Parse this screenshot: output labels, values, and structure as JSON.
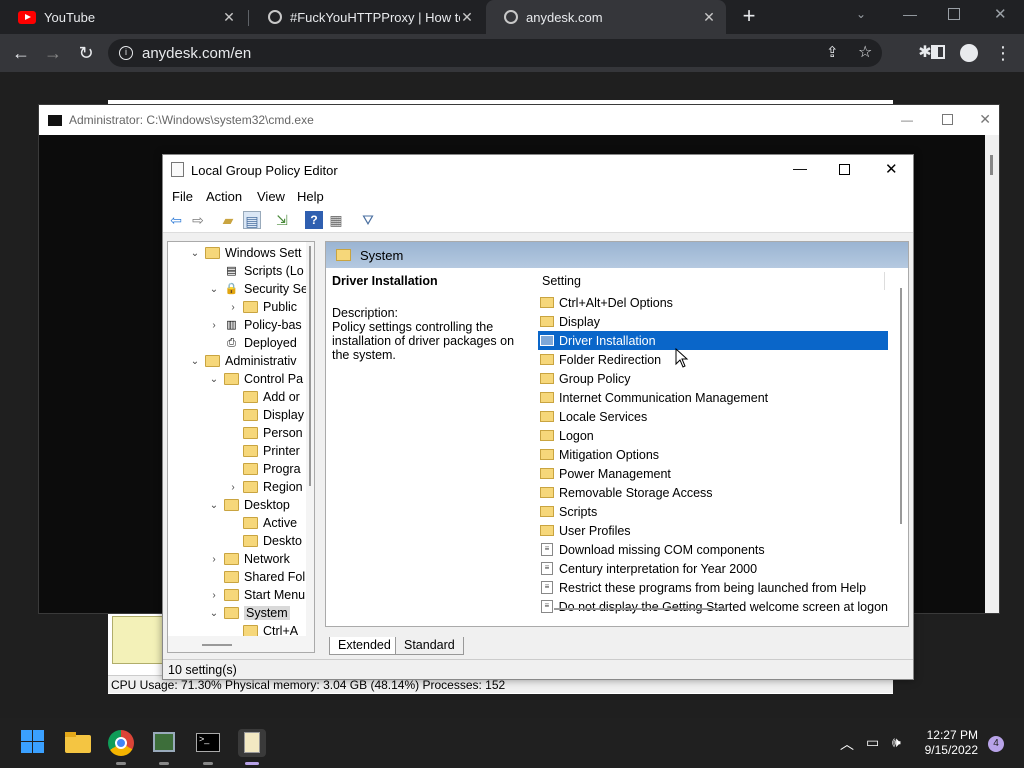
{
  "browser": {
    "tabs": [
      {
        "title": "YouTube",
        "active": false
      },
      {
        "title": "#FuckYouHTTPProxy | How to use",
        "active": false
      },
      {
        "title": "anydesk.com",
        "active": true
      }
    ],
    "url": "anydesk.com/en"
  },
  "cmd": {
    "title": "Administrator: C:\\Windows\\system32\\cmd.exe"
  },
  "task_manager": {
    "status": "CPU Usage: 71.30%    Physical memory: 3.04 GB (48.14%)    Processes: 152"
  },
  "gpe": {
    "title": "Local Group Policy Editor",
    "menu": [
      "File",
      "Action",
      "View",
      "Help"
    ],
    "tree": [
      {
        "label": "Windows Sett",
        "level": 1,
        "expander": "v",
        "icon": "folder"
      },
      {
        "label": "Scripts (Lo",
        "level": 2,
        "expander": "",
        "icon": "script"
      },
      {
        "label": "Security Se",
        "level": 2,
        "expander": "v",
        "icon": "security"
      },
      {
        "label": "Public",
        "level": 3,
        "expander": ">",
        "icon": "folder"
      },
      {
        "label": "Policy-bas",
        "level": 2,
        "expander": ">",
        "icon": "chart"
      },
      {
        "label": "Deployed",
        "level": 2,
        "expander": "",
        "icon": "printer"
      },
      {
        "label": "Administrativ",
        "level": 1,
        "expander": "v",
        "icon": "folder"
      },
      {
        "label": "Control Pa",
        "level": 2,
        "expander": "v",
        "icon": "folder"
      },
      {
        "label": "Add or",
        "level": 3,
        "expander": "",
        "icon": "folder"
      },
      {
        "label": "Display",
        "level": 3,
        "expander": "",
        "icon": "folder"
      },
      {
        "label": "Person",
        "level": 3,
        "expander": "",
        "icon": "folder"
      },
      {
        "label": "Printer",
        "level": 3,
        "expander": "",
        "icon": "folder"
      },
      {
        "label": "Progra",
        "level": 3,
        "expander": "",
        "icon": "folder"
      },
      {
        "label": "Region",
        "level": 3,
        "expander": ">",
        "icon": "folder"
      },
      {
        "label": "Desktop",
        "level": 2,
        "expander": "v",
        "icon": "folder"
      },
      {
        "label": "Active",
        "level": 3,
        "expander": "",
        "icon": "folder"
      },
      {
        "label": "Deskto",
        "level": 3,
        "expander": "",
        "icon": "folder"
      },
      {
        "label": "Network",
        "level": 2,
        "expander": ">",
        "icon": "folder"
      },
      {
        "label": "Shared Fol",
        "level": 2,
        "expander": "",
        "icon": "folder"
      },
      {
        "label": "Start Menu",
        "level": 2,
        "expander": ">",
        "icon": "folder"
      },
      {
        "label": "System",
        "level": 2,
        "expander": "v",
        "icon": "folder",
        "selected": true
      },
      {
        "label": "Ctrl+A",
        "level": 3,
        "expander": "",
        "icon": "folder"
      }
    ],
    "header": "System",
    "description": {
      "title": "Driver Installation",
      "label": "Description:",
      "text": "Policy settings controlling the installation of driver packages on the system."
    },
    "column": "Setting",
    "settings": [
      {
        "label": "Ctrl+Alt+Del Options",
        "type": "folder"
      },
      {
        "label": "Display",
        "type": "folder"
      },
      {
        "label": "Driver Installation",
        "type": "folder",
        "selected": true
      },
      {
        "label": "Folder Redirection",
        "type": "folder"
      },
      {
        "label": "Group Policy",
        "type": "folder"
      },
      {
        "label": "Internet Communication Management",
        "type": "folder"
      },
      {
        "label": "Locale Services",
        "type": "folder"
      },
      {
        "label": "Logon",
        "type": "folder"
      },
      {
        "label": "Mitigation Options",
        "type": "folder"
      },
      {
        "label": "Power Management",
        "type": "folder"
      },
      {
        "label": "Removable Storage Access",
        "type": "folder"
      },
      {
        "label": "Scripts",
        "type": "folder"
      },
      {
        "label": "User Profiles",
        "type": "folder"
      },
      {
        "label": "Download missing COM components",
        "type": "policy"
      },
      {
        "label": "Century interpretation for Year 2000",
        "type": "policy"
      },
      {
        "label": "Restrict these programs from being launched from Help",
        "type": "policy"
      },
      {
        "label": "Do not display the Getting Started welcome screen at logon",
        "type": "policy"
      }
    ],
    "tabs": [
      "Extended",
      "Standard"
    ],
    "status": "10 setting(s)"
  },
  "taskbar": {
    "time": "12:27 PM",
    "date": "9/15/2022",
    "notifications": "4"
  },
  "colors": {
    "selection": "#0a66c9",
    "header_gradient": "#9ab4d2",
    "youtube_red": "#ff0000"
  }
}
